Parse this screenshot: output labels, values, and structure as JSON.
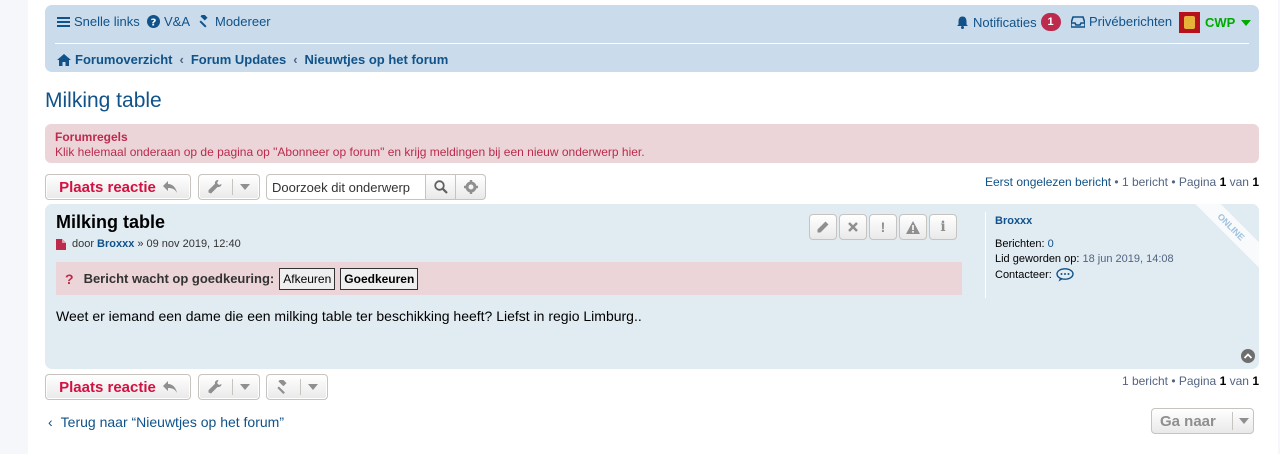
{
  "navbar": {
    "quick_links": "Snelle links",
    "faq": "V&A",
    "moderate": "Modereer",
    "notifications": "Notificaties",
    "notifications_count": "1",
    "private_messages": "Privéberichten",
    "username": "CWP",
    "breadcrumbs": [
      "Forumoverzicht",
      "Forum Updates",
      "Nieuwtjes op het forum"
    ]
  },
  "topic": {
    "title": "Milking table"
  },
  "rules": {
    "title": "Forumregels",
    "text": "Klik helemaal onderaan op de pagina op \"Abonneer op forum\" en krijg meldingen bij een nieuw onderwerp hier."
  },
  "actions": {
    "reply_label": "Plaats reactie",
    "search_value": "Doorzoek dit onderwerp"
  },
  "pagination_top": {
    "first_unread": "Eerst ongelezen bericht",
    "sep": " • ",
    "post_count": "1 bericht",
    "page_word": "Pagina",
    "page_current": "1",
    "of_word": "van",
    "page_total": "1"
  },
  "pagination_bottom": {
    "post_count": "1 bericht",
    "sep": " • ",
    "page_word": "Pagina",
    "page_current": "1",
    "of_word": "van",
    "page_total": "1"
  },
  "post": {
    "title": "Milking table",
    "by": "door",
    "author": "Broxxx",
    "date": "» 09 nov 2019, 12:40",
    "queue_mark": "?",
    "queue_text": "Bericht wacht op goedkeuring:",
    "disapprove": "Afkeuren",
    "approve": "Goedkeuren",
    "content": "Weet er iemand een dame die een milking table ter beschikking heeft? Liefst in regio Limburg..",
    "buttons": [
      "edit",
      "delete",
      "warn",
      "report",
      "info"
    ],
    "warn_glyph": "!",
    "info_glyph": "i"
  },
  "profile": {
    "name": "Broxxx",
    "posts_label": "Berichten:",
    "posts_value": "0",
    "joined_label": "Lid geworden op:",
    "joined_value": "18 jun 2019, 14:08",
    "contact_label": "Contacteer:",
    "online": "ONLINE"
  },
  "footer": {
    "back_label": "Terug naar “Nieuwtjes op het forum”",
    "jump_label": "Ga naar"
  },
  "colors": {
    "navbar_bg": "#cadceb",
    "post_bg": "#e1ebf2",
    "rules_bg": "#ecd5d8",
    "link": "#105289",
    "accent_red": "#d31141",
    "online_green": "#00aa00"
  }
}
